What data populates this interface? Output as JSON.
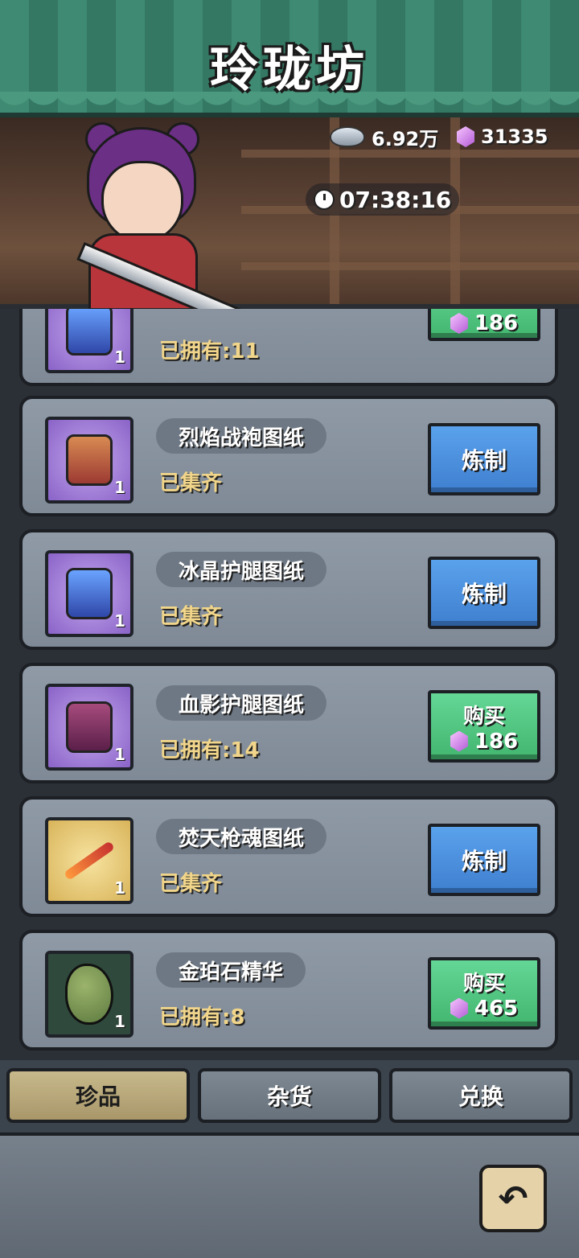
{
  "title": "玲珑坊",
  "currency": {
    "silver": "6.92万",
    "gems": "31335"
  },
  "timer": "07:38:16",
  "items": [
    {
      "name": "",
      "status": "已拥有:11",
      "count": "1",
      "button": {
        "type": "buy",
        "label": "",
        "price": "186"
      },
      "icon": "armor-blueprint-icon"
    },
    {
      "name": "烈焰战袍图纸",
      "status": "已集齐",
      "count": "1",
      "button": {
        "type": "craft",
        "label": "炼制"
      },
      "icon": "flame-robe-blueprint-icon"
    },
    {
      "name": "冰晶护腿图纸",
      "status": "已集齐",
      "count": "1",
      "button": {
        "type": "craft",
        "label": "炼制"
      },
      "icon": "ice-crystal-leggings-blueprint-icon"
    },
    {
      "name": "血影护腿图纸",
      "status": "已拥有:14",
      "count": "1",
      "button": {
        "type": "buy",
        "label": "购买",
        "price": "186"
      },
      "icon": "blood-shadow-leggings-blueprint-icon"
    },
    {
      "name": "焚天枪魂图纸",
      "status": "已集齐",
      "count": "1",
      "button": {
        "type": "craft",
        "label": "炼制"
      },
      "icon": "burning-spear-blueprint-icon"
    },
    {
      "name": "金珀石精华",
      "status": "已拥有:8",
      "count": "1",
      "button": {
        "type": "buy",
        "label": "购买",
        "price": "465"
      },
      "icon": "amber-stone-essence-icon"
    }
  ],
  "tabs": [
    "珍品",
    "杂货",
    "兑换"
  ],
  "active_tab": "珍品"
}
